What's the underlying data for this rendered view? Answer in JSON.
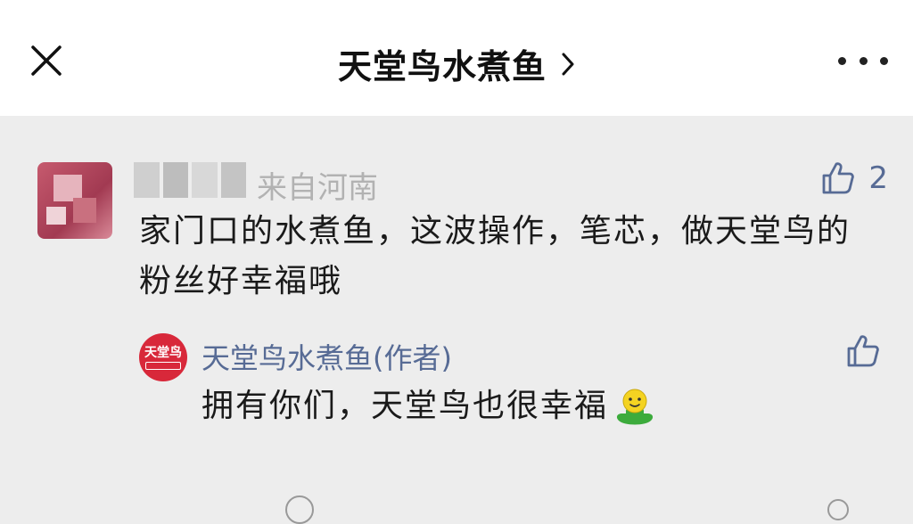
{
  "nav": {
    "title": "天堂鸟水煮鱼",
    "close_icon": "close-icon",
    "more_icon": "more-icon",
    "chevron_icon": "chevron-right-icon"
  },
  "comment": {
    "location": "来自河南",
    "like_count": "2",
    "text": "家门口的水煮鱼，这波操作，笔芯，做天堂鸟的粉丝好幸福哦"
  },
  "reply": {
    "author": "天堂鸟水煮鱼(作者)",
    "avatar_text": "天堂鸟",
    "text": "拥有你们，天堂鸟也很幸福"
  },
  "colors": {
    "accent": "#576b95",
    "background": "#ededed",
    "brand_red": "#d8283a"
  }
}
